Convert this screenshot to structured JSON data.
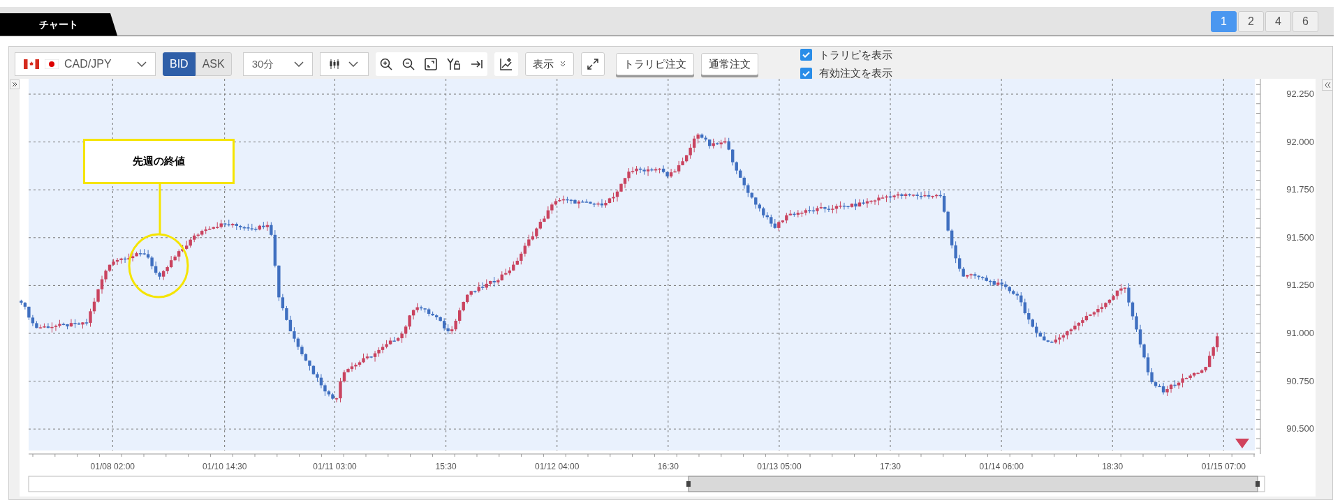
{
  "tab": {
    "label": "チャート",
    "selected": true
  },
  "layout_buttons": [
    {
      "label": "1",
      "selected": true
    },
    {
      "label": "2",
      "selected": false
    },
    {
      "label": "4",
      "selected": false
    },
    {
      "label": "6",
      "selected": false
    }
  ],
  "toolbar": {
    "symbol": "CAD/JPY",
    "timeframe": "30分",
    "display_button": "表示",
    "price_sides": [
      {
        "label": "BID",
        "selected": true
      },
      {
        "label": "ASK",
        "selected": false
      }
    ],
    "order_buttons": [
      "トラリピ注文",
      "通常注文"
    ]
  },
  "options": [
    {
      "label": "トラリピを表示",
      "checked": true
    },
    {
      "label": "有効注文を表示",
      "checked": true
    }
  ],
  "chart": {
    "annotation": "先週の終値",
    "y_axis_labels": [
      "92.250",
      "92.000",
      "91.750",
      "91.500",
      "91.250",
      "91.000",
      "90.750",
      "90.500"
    ],
    "x_axis_labels": [
      "01/08 02:00",
      "01/10 14:30",
      "01/11 03:00",
      "15:30",
      "01/12 04:00",
      "16:30",
      "01/13 05:00",
      "17:30",
      "01/14 06:00",
      "18:30",
      "01/15 07:00"
    ]
  }
}
